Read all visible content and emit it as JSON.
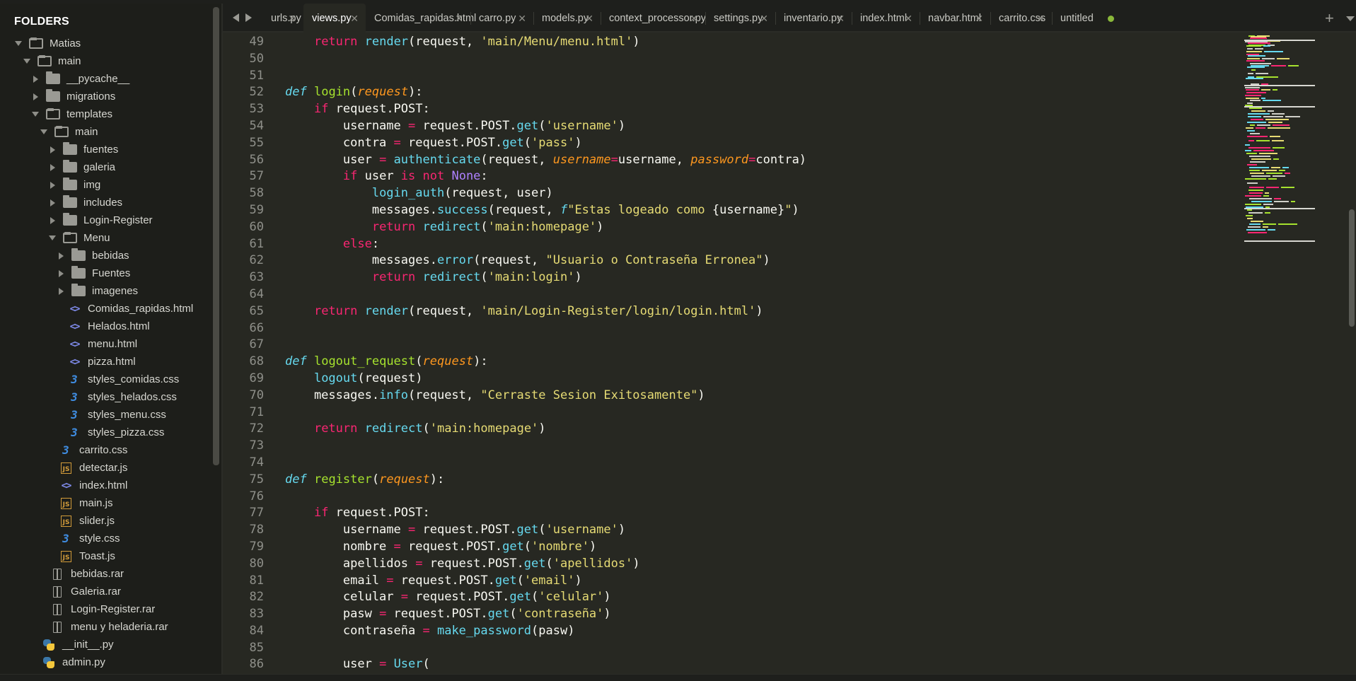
{
  "sidebar": {
    "title": "FOLDERS",
    "tree": [
      {
        "label": "Matias",
        "type": "folder",
        "depth": 0,
        "state": "open"
      },
      {
        "label": "main",
        "type": "folder",
        "depth": 1,
        "state": "open"
      },
      {
        "label": "__pycache__",
        "type": "folder",
        "depth": 2,
        "state": "closed"
      },
      {
        "label": "migrations",
        "type": "folder",
        "depth": 2,
        "state": "closed"
      },
      {
        "label": "templates",
        "type": "folder",
        "depth": 2,
        "state": "open"
      },
      {
        "label": "main",
        "type": "folder",
        "depth": 3,
        "state": "open"
      },
      {
        "label": "fuentes",
        "type": "folder",
        "depth": 4,
        "state": "closed"
      },
      {
        "label": "galeria",
        "type": "folder",
        "depth": 4,
        "state": "closed"
      },
      {
        "label": "img",
        "type": "folder",
        "depth": 4,
        "state": "closed"
      },
      {
        "label": "includes",
        "type": "folder",
        "depth": 4,
        "state": "closed"
      },
      {
        "label": "Login-Register",
        "type": "folder",
        "depth": 4,
        "state": "closed"
      },
      {
        "label": "Menu",
        "type": "folder",
        "depth": 4,
        "state": "open"
      },
      {
        "label": "bebidas",
        "type": "folder",
        "depth": 5,
        "state": "closed"
      },
      {
        "label": "Fuentes",
        "type": "folder",
        "depth": 5,
        "state": "closed"
      },
      {
        "label": "imagenes",
        "type": "folder",
        "depth": 5,
        "state": "closed"
      },
      {
        "label": "Comidas_rapidas.html",
        "type": "html",
        "depth": 5
      },
      {
        "label": "Helados.html",
        "type": "html",
        "depth": 5
      },
      {
        "label": "menu.html",
        "type": "html",
        "depth": 5
      },
      {
        "label": "pizza.html",
        "type": "html",
        "depth": 5
      },
      {
        "label": "styles_comidas.css",
        "type": "css",
        "depth": 5
      },
      {
        "label": "styles_helados.css",
        "type": "css",
        "depth": 5
      },
      {
        "label": "styles_menu.css",
        "type": "css",
        "depth": 5
      },
      {
        "label": "styles_pizza.css",
        "type": "css",
        "depth": 5
      },
      {
        "label": "carrito.css",
        "type": "css",
        "depth": 4
      },
      {
        "label": "detectar.js",
        "type": "js",
        "depth": 4
      },
      {
        "label": "index.html",
        "type": "html",
        "depth": 4
      },
      {
        "label": "main.js",
        "type": "js",
        "depth": 4
      },
      {
        "label": "slider.js",
        "type": "js",
        "depth": 4
      },
      {
        "label": "style.css",
        "type": "css",
        "depth": 4
      },
      {
        "label": "Toast.js",
        "type": "js",
        "depth": 4
      },
      {
        "label": "bebidas.rar",
        "type": "rar",
        "depth": 3
      },
      {
        "label": "Galeria.rar",
        "type": "rar",
        "depth": 3
      },
      {
        "label": "Login-Register.rar",
        "type": "rar",
        "depth": 3
      },
      {
        "label": "menu y heladeria.rar",
        "type": "rar",
        "depth": 3
      },
      {
        "label": "__init__.py",
        "type": "py",
        "depth": 2
      },
      {
        "label": "admin.py",
        "type": "py",
        "depth": 2
      }
    ]
  },
  "tabs": [
    {
      "label": "urls.py",
      "active": false,
      "marker": "close"
    },
    {
      "label": "views.py",
      "active": true,
      "marker": "close"
    },
    {
      "label": "Comidas_rapidas.html",
      "active": false,
      "marker": "close"
    },
    {
      "label": "carro.py",
      "active": false,
      "marker": "close"
    },
    {
      "label": "models.py",
      "active": false,
      "marker": "close"
    },
    {
      "label": "context_processor.py",
      "active": false,
      "marker": "close"
    },
    {
      "label": "settings.py",
      "active": false,
      "marker": "close"
    },
    {
      "label": "inventario.py",
      "active": false,
      "marker": "close"
    },
    {
      "label": "index.html",
      "active": false,
      "marker": "close"
    },
    {
      "label": "navbar.html",
      "active": false,
      "marker": "close"
    },
    {
      "label": "carrito.css",
      "active": false,
      "marker": "close"
    },
    {
      "label": "untitled",
      "active": false,
      "marker": "dirty"
    }
  ],
  "tabbar": {
    "new_tab": "+"
  },
  "editor": {
    "lines": [
      {
        "n": "49",
        "tokens": [
          [
            "",
            "    "
          ],
          [
            "kw",
            "return"
          ],
          [
            "",
            " "
          ],
          [
            "bi",
            "render"
          ],
          [
            "",
            "(request, "
          ],
          [
            "str",
            "'main/Menu/menu.html'"
          ],
          [
            "",
            ")"
          ]
        ]
      },
      {
        "n": "50",
        "tokens": []
      },
      {
        "n": "51",
        "tokens": []
      },
      {
        "n": "52",
        "tokens": [
          [
            "def",
            "def"
          ],
          [
            "",
            " "
          ],
          [
            "fn",
            "login"
          ],
          [
            "",
            "("
          ],
          [
            "par",
            "request"
          ],
          [
            "",
            "):"
          ]
        ]
      },
      {
        "n": "53",
        "tokens": [
          [
            "",
            "    "
          ],
          [
            "kw",
            "if"
          ],
          [
            "",
            " request.POST:"
          ]
        ]
      },
      {
        "n": "54",
        "tokens": [
          [
            "",
            "        username "
          ],
          [
            "kw",
            "="
          ],
          [
            "",
            " request.POST."
          ],
          [
            "bi",
            "get"
          ],
          [
            "",
            "("
          ],
          [
            "str",
            "'username'"
          ],
          [
            "",
            ")"
          ]
        ]
      },
      {
        "n": "55",
        "tokens": [
          [
            "",
            "        contra "
          ],
          [
            "kw",
            "="
          ],
          [
            "",
            " request.POST."
          ],
          [
            "bi",
            "get"
          ],
          [
            "",
            "("
          ],
          [
            "str",
            "'pass'"
          ],
          [
            "",
            ")"
          ]
        ]
      },
      {
        "n": "56",
        "tokens": [
          [
            "",
            "        user "
          ],
          [
            "kw",
            "="
          ],
          [
            "",
            " "
          ],
          [
            "bi",
            "authenticate"
          ],
          [
            "",
            "(request, "
          ],
          [
            "par",
            "username"
          ],
          [
            "kw",
            "="
          ],
          [
            "",
            "username, "
          ],
          [
            "par",
            "password"
          ],
          [
            "kw",
            "="
          ],
          [
            "",
            "contra)"
          ]
        ]
      },
      {
        "n": "57",
        "tokens": [
          [
            "",
            "        "
          ],
          [
            "kw",
            "if"
          ],
          [
            "",
            " user "
          ],
          [
            "kw",
            "is not"
          ],
          [
            "",
            " "
          ],
          [
            "const",
            "None"
          ],
          [
            "",
            ":"
          ]
        ]
      },
      {
        "n": "58",
        "tokens": [
          [
            "",
            "            "
          ],
          [
            "bi",
            "login_auth"
          ],
          [
            "",
            "(request, user)"
          ]
        ]
      },
      {
        "n": "59",
        "tokens": [
          [
            "",
            "            messages."
          ],
          [
            "bi",
            "success"
          ],
          [
            "",
            "(request, "
          ],
          [
            "def",
            "f"
          ],
          [
            "str",
            "\"Estas logeado como "
          ],
          [
            "",
            "{username}"
          ],
          [
            "str",
            "\""
          ],
          [
            "",
            ")"
          ]
        ]
      },
      {
        "n": "60",
        "tokens": [
          [
            "",
            "            "
          ],
          [
            "kw",
            "return"
          ],
          [
            "",
            " "
          ],
          [
            "bi",
            "redirect"
          ],
          [
            "",
            "("
          ],
          [
            "str",
            "'main:homepage'"
          ],
          [
            "",
            ")"
          ]
        ]
      },
      {
        "n": "61",
        "tokens": [
          [
            "",
            "        "
          ],
          [
            "kw",
            "else"
          ],
          [
            "",
            ":"
          ]
        ]
      },
      {
        "n": "62",
        "tokens": [
          [
            "",
            "            messages."
          ],
          [
            "bi",
            "error"
          ],
          [
            "",
            "(request, "
          ],
          [
            "str",
            "\"Usuario o Contraseña Erronea\""
          ],
          [
            "",
            ")"
          ]
        ]
      },
      {
        "n": "63",
        "tokens": [
          [
            "",
            "            "
          ],
          [
            "kw",
            "return"
          ],
          [
            "",
            " "
          ],
          [
            "bi",
            "redirect"
          ],
          [
            "",
            "("
          ],
          [
            "str",
            "'main:login'"
          ],
          [
            "",
            ")"
          ]
        ]
      },
      {
        "n": "64",
        "tokens": []
      },
      {
        "n": "65",
        "tokens": [
          [
            "",
            "    "
          ],
          [
            "kw",
            "return"
          ],
          [
            "",
            " "
          ],
          [
            "bi",
            "render"
          ],
          [
            "",
            "(request, "
          ],
          [
            "str",
            "'main/Login-Register/login/login.html'"
          ],
          [
            "",
            ")"
          ]
        ]
      },
      {
        "n": "66",
        "tokens": []
      },
      {
        "n": "67",
        "tokens": []
      },
      {
        "n": "68",
        "tokens": [
          [
            "def",
            "def"
          ],
          [
            "",
            " "
          ],
          [
            "fn",
            "logout_request"
          ],
          [
            "",
            "("
          ],
          [
            "par",
            "request"
          ],
          [
            "",
            "):"
          ]
        ]
      },
      {
        "n": "69",
        "tokens": [
          [
            "",
            "    "
          ],
          [
            "bi",
            "logout"
          ],
          [
            "",
            "(request)"
          ]
        ]
      },
      {
        "n": "70",
        "tokens": [
          [
            "",
            "    messages."
          ],
          [
            "bi",
            "info"
          ],
          [
            "",
            "(request, "
          ],
          [
            "str",
            "\"Cerraste Sesion Exitosamente\""
          ],
          [
            "",
            ")"
          ]
        ]
      },
      {
        "n": "71",
        "tokens": []
      },
      {
        "n": "72",
        "tokens": [
          [
            "",
            "    "
          ],
          [
            "kw",
            "return"
          ],
          [
            "",
            " "
          ],
          [
            "bi",
            "redirect"
          ],
          [
            "",
            "("
          ],
          [
            "str",
            "'main:homepage'"
          ],
          [
            "",
            ")"
          ]
        ]
      },
      {
        "n": "73",
        "tokens": []
      },
      {
        "n": "74",
        "tokens": []
      },
      {
        "n": "75",
        "tokens": [
          [
            "def",
            "def"
          ],
          [
            "",
            " "
          ],
          [
            "fn",
            "register"
          ],
          [
            "",
            "("
          ],
          [
            "par",
            "request"
          ],
          [
            "",
            "):"
          ]
        ]
      },
      {
        "n": "76",
        "tokens": []
      },
      {
        "n": "77",
        "tokens": [
          [
            "",
            "    "
          ],
          [
            "kw",
            "if"
          ],
          [
            "",
            " request.POST:"
          ]
        ]
      },
      {
        "n": "78",
        "tokens": [
          [
            "",
            "        username "
          ],
          [
            "kw",
            "="
          ],
          [
            "",
            " request.POST."
          ],
          [
            "bi",
            "get"
          ],
          [
            "",
            "("
          ],
          [
            "str",
            "'username'"
          ],
          [
            "",
            ")"
          ]
        ]
      },
      {
        "n": "79",
        "tokens": [
          [
            "",
            "        nombre "
          ],
          [
            "kw",
            "="
          ],
          [
            "",
            " request.POST."
          ],
          [
            "bi",
            "get"
          ],
          [
            "",
            "("
          ],
          [
            "str",
            "'nombre'"
          ],
          [
            "",
            ")"
          ]
        ]
      },
      {
        "n": "80",
        "tokens": [
          [
            "",
            "        apellidos "
          ],
          [
            "kw",
            "="
          ],
          [
            "",
            " request.POST."
          ],
          [
            "bi",
            "get"
          ],
          [
            "",
            "("
          ],
          [
            "str",
            "'apellidos'"
          ],
          [
            "",
            ")"
          ]
        ]
      },
      {
        "n": "81",
        "tokens": [
          [
            "",
            "        email "
          ],
          [
            "kw",
            "="
          ],
          [
            "",
            " request.POST."
          ],
          [
            "bi",
            "get"
          ],
          [
            "",
            "("
          ],
          [
            "str",
            "'email'"
          ],
          [
            "",
            ")"
          ]
        ]
      },
      {
        "n": "82",
        "tokens": [
          [
            "",
            "        celular "
          ],
          [
            "kw",
            "="
          ],
          [
            "",
            " request.POST."
          ],
          [
            "bi",
            "get"
          ],
          [
            "",
            "("
          ],
          [
            "str",
            "'celular'"
          ],
          [
            "",
            ")"
          ]
        ]
      },
      {
        "n": "83",
        "tokens": [
          [
            "",
            "        pasw "
          ],
          [
            "kw",
            "="
          ],
          [
            "",
            " request.POST."
          ],
          [
            "bi",
            "get"
          ],
          [
            "",
            "("
          ],
          [
            "str",
            "'contraseña'"
          ],
          [
            "",
            ")"
          ]
        ]
      },
      {
        "n": "84",
        "tokens": [
          [
            "",
            "        contraseña "
          ],
          [
            "kw",
            "="
          ],
          [
            "",
            " "
          ],
          [
            "bi",
            "make_password"
          ],
          [
            "",
            "(pasw)"
          ]
        ]
      },
      {
        "n": "85",
        "tokens": []
      },
      {
        "n": "86",
        "tokens": [
          [
            "",
            "        user "
          ],
          [
            "kw",
            "="
          ],
          [
            "",
            " "
          ],
          [
            "bi",
            "User"
          ],
          [
            "",
            "("
          ]
        ]
      }
    ]
  },
  "colors": {
    "background": "#272822",
    "sidebar": "#1d1e1a",
    "keyword": "#f92672",
    "function": "#a6e22e",
    "builtin": "#66d9ef",
    "string": "#e6db74",
    "parameter": "#fd971f",
    "constant": "#ae81ff"
  }
}
